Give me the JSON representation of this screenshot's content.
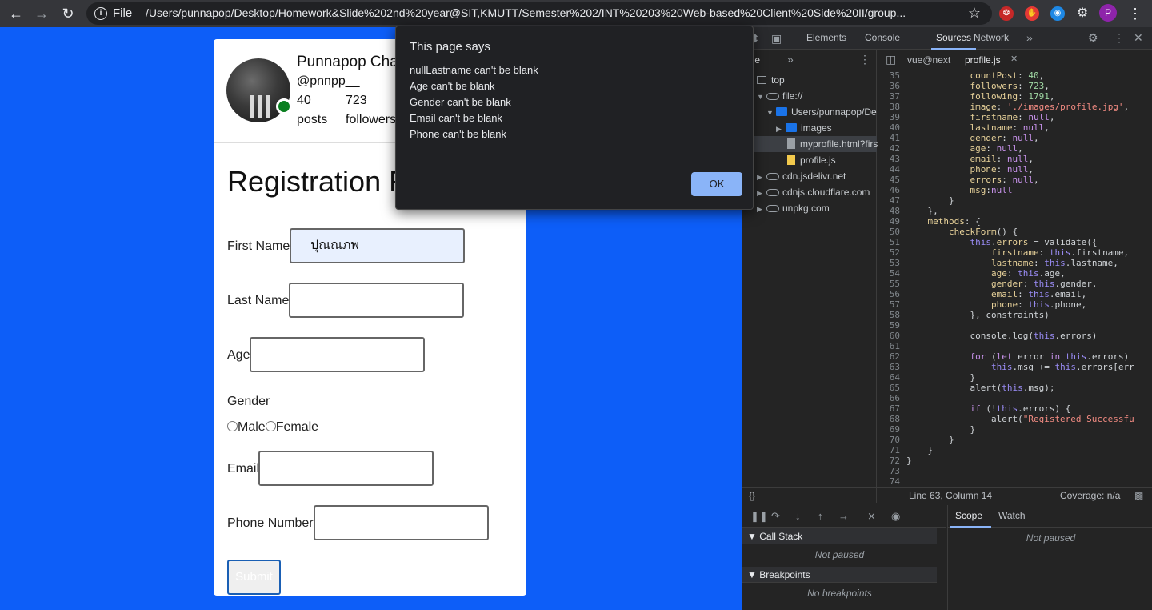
{
  "browser": {
    "scheme_label": "File",
    "url": "/Users/punnapop/Desktop/Homework&Slide%202nd%20year@SIT,KMUTT/Semester%202/INT%20203%20Web-based%20Client%20Side%20II/group...",
    "profile_initial": "P"
  },
  "profile": {
    "name": "Punnapop Cha",
    "handle": "@pnnpp__",
    "posts_count": "40",
    "posts_label": "posts",
    "followers_count": "723",
    "followers_label": "followers"
  },
  "form": {
    "title": "Registration F",
    "first_name_label": "First Name",
    "first_name_value": "ปุณณภพ",
    "last_name_label": "Last Name",
    "last_name_value": "",
    "age_label": "Age",
    "age_value": "",
    "gender_label": "Gender",
    "gender_options": [
      "Male",
      "Female"
    ],
    "email_label": "Email",
    "email_value": "",
    "phone_label": "Phone Number",
    "phone_value": "",
    "submit_label": "Submit"
  },
  "dialog": {
    "title": "This page says",
    "messages": [
      "nullLastname can't be blank",
      "Age can't be blank",
      "Gender can't be blank",
      "Email can't be blank",
      "Phone can't be blank"
    ],
    "ok_label": "OK"
  },
  "devtools": {
    "tabs": [
      "Elements",
      "Console",
      "Sources",
      "Network"
    ],
    "active_tab": "Sources",
    "nav_subtab": "age",
    "tree": [
      {
        "label": "top",
        "icon": "frame"
      },
      {
        "label": "file://",
        "icon": "cloud"
      },
      {
        "label": "Users/punnapop/De",
        "icon": "folder"
      },
      {
        "label": "images",
        "icon": "folder"
      },
      {
        "label": "myprofile.html?firs",
        "icon": "file"
      },
      {
        "label": "profile.js",
        "icon": "js-file"
      },
      {
        "label": "cdn.jsdelivr.net",
        "icon": "cloud"
      },
      {
        "label": "cdnjs.cloudflare.com",
        "icon": "cloud"
      },
      {
        "label": "unpkg.com",
        "icon": "cloud"
      }
    ],
    "editor_tabs": [
      "vue@next",
      "profile.js"
    ],
    "code_lines": [
      {
        "n": "35",
        "html": "            <span class=\"prop\">countPost</span>: <span class=\"num\">40</span>,"
      },
      {
        "n": "36",
        "html": "            <span class=\"prop\">followers</span>: <span class=\"num\">723</span>,"
      },
      {
        "n": "37",
        "html": "            <span class=\"prop\">following</span>: <span class=\"num\">1791</span>,"
      },
      {
        "n": "38",
        "html": "            <span class=\"prop\">image</span>: <span class=\"str\">'./images/profile.jpg'</span>,"
      },
      {
        "n": "39",
        "html": "            <span class=\"prop\">firstname</span>: <span class=\"kw\">null</span>,"
      },
      {
        "n": "40",
        "html": "            <span class=\"prop\">lastname</span>: <span class=\"kw\">null</span>,"
      },
      {
        "n": "41",
        "html": "            <span class=\"prop\">gender</span>: <span class=\"kw\">null</span>,"
      },
      {
        "n": "42",
        "html": "            <span class=\"prop\">age</span>: <span class=\"kw\">null</span>,"
      },
      {
        "n": "43",
        "html": "            <span class=\"prop\">email</span>: <span class=\"kw\">null</span>,"
      },
      {
        "n": "44",
        "html": "            <span class=\"prop\">phone</span>: <span class=\"kw\">null</span>,"
      },
      {
        "n": "45",
        "html": "            <span class=\"prop\">errors</span>: <span class=\"kw\">null</span>,"
      },
      {
        "n": "46",
        "html": "            <span class=\"prop\">msg</span>:<span class=\"kw\">null</span>"
      },
      {
        "n": "47",
        "html": "        }"
      },
      {
        "n": "48",
        "html": "    },"
      },
      {
        "n": "49",
        "html": "    <span class=\"prop\">methods</span>: {"
      },
      {
        "n": "50",
        "html": "        <span class=\"prop\">checkForm</span>() {"
      },
      {
        "n": "51",
        "html": "            <span class=\"this\">this</span>.<span class=\"prop\">errors</span> = validate({"
      },
      {
        "n": "52",
        "html": "                <span class=\"prop\">firstname</span>: <span class=\"this\">this</span>.firstname,"
      },
      {
        "n": "53",
        "html": "                <span class=\"prop\">lastname</span>: <span class=\"this\">this</span>.lastname,"
      },
      {
        "n": "54",
        "html": "                <span class=\"prop\">age</span>: <span class=\"this\">this</span>.age,"
      },
      {
        "n": "55",
        "html": "                <span class=\"prop\">gender</span>: <span class=\"this\">this</span>.gender,"
      },
      {
        "n": "56",
        "html": "                <span class=\"prop\">email</span>: <span class=\"this\">this</span>.email,"
      },
      {
        "n": "57",
        "html": "                <span class=\"prop\">phone</span>: <span class=\"this\">this</span>.phone,"
      },
      {
        "n": "58",
        "html": "            }, constraints)"
      },
      {
        "n": "59",
        "html": ""
      },
      {
        "n": "60",
        "html": "            console.log(<span class=\"this\">this</span>.errors)"
      },
      {
        "n": "61",
        "html": ""
      },
      {
        "n": "62",
        "html": "            <span class=\"kw\">for</span> (<span class=\"kw\">let</span> error <span class=\"kw\">in</span> <span class=\"this\">this</span>.errors)"
      },
      {
        "n": "63",
        "html": "                <span class=\"this\">this</span>.msg += <span class=\"this\">this</span>.errors[err"
      },
      {
        "n": "64",
        "html": "            }"
      },
      {
        "n": "65",
        "html": "            alert(<span class=\"this\">this</span>.msg);"
      },
      {
        "n": "66",
        "html": ""
      },
      {
        "n": "67",
        "html": "            <span class=\"kw\">if</span> (!<span class=\"this\">this</span>.errors) {"
      },
      {
        "n": "68",
        "html": "                alert(<span class=\"str\">\"Registered Successfu</span>"
      },
      {
        "n": "69",
        "html": "            }"
      },
      {
        "n": "70",
        "html": "        }"
      },
      {
        "n": "71",
        "html": "    }"
      },
      {
        "n": "72",
        "html": "}"
      },
      {
        "n": "73",
        "html": ""
      },
      {
        "n": "74",
        "html": ""
      }
    ],
    "status_position": "Line 63, Column 14",
    "status_coverage": "Coverage: n/a",
    "call_stack_label": "Call Stack",
    "call_stack_empty": "Not paused",
    "breakpoints_label": "Breakpoints",
    "breakpoints_empty": "No breakpoints",
    "scope_tabs": [
      "Scope",
      "Watch"
    ],
    "scope_empty": "Not paused"
  },
  "colors": {
    "page_bg": "#0d5ef8",
    "devtools_bg": "#242424",
    "accent": "#8ab4f8",
    "online": "#0a7f20"
  }
}
